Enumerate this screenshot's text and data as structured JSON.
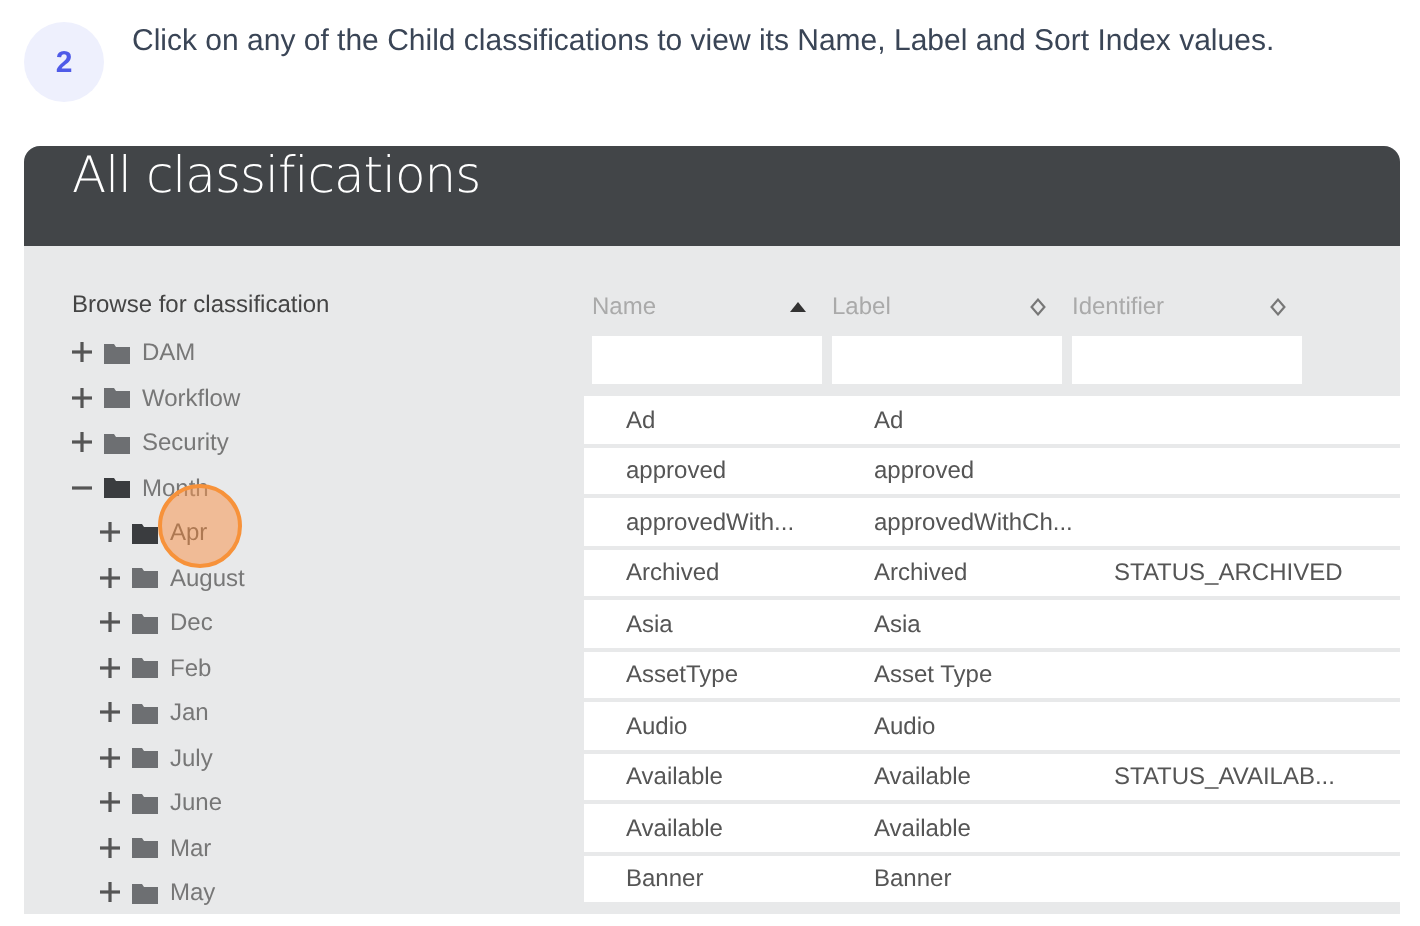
{
  "step": {
    "number": "2",
    "text": "Click on any of the Child classifications to view its Name, Label and Sort Index values."
  },
  "panel": {
    "title": "All classifications"
  },
  "browser": {
    "heading": "Browse for classification",
    "tree": [
      {
        "label": "DAM",
        "expanded": false,
        "selected": false
      },
      {
        "label": "Workflow",
        "expanded": false,
        "selected": false
      },
      {
        "label": "Security",
        "expanded": false,
        "selected": false
      },
      {
        "label": "Month",
        "expanded": true,
        "selected": false,
        "children": [
          {
            "label": "Apr",
            "expanded": false,
            "selected": true
          },
          {
            "label": "August",
            "expanded": false,
            "selected": false
          },
          {
            "label": "Dec",
            "expanded": false,
            "selected": false
          },
          {
            "label": "Feb",
            "expanded": false,
            "selected": false
          },
          {
            "label": "Jan",
            "expanded": false,
            "selected": false
          },
          {
            "label": "July",
            "expanded": false,
            "selected": false
          },
          {
            "label": "June",
            "expanded": false,
            "selected": false
          },
          {
            "label": "Mar",
            "expanded": false,
            "selected": false
          },
          {
            "label": "May",
            "expanded": false,
            "selected": false
          }
        ]
      }
    ]
  },
  "table": {
    "columns": [
      {
        "label": "Name",
        "sorted": true
      },
      {
        "label": "Label",
        "sorted": false
      },
      {
        "label": "Identifier",
        "sorted": false
      }
    ],
    "rows": [
      [
        "Ad",
        "Ad",
        ""
      ],
      [
        "approved",
        "approved",
        ""
      ],
      [
        "approvedWith...",
        "approvedWithCh...",
        ""
      ],
      [
        "Archived",
        "Archived",
        "STATUS_ARCHIVED"
      ],
      [
        "Asia",
        "Asia",
        ""
      ],
      [
        "AssetType",
        "Asset Type",
        ""
      ],
      [
        "Audio",
        "Audio",
        ""
      ],
      [
        "Available",
        "Available",
        "STATUS_AVAILAB..."
      ],
      [
        "Available",
        "Available",
        ""
      ],
      [
        "Banner",
        "Banner",
        ""
      ]
    ]
  }
}
